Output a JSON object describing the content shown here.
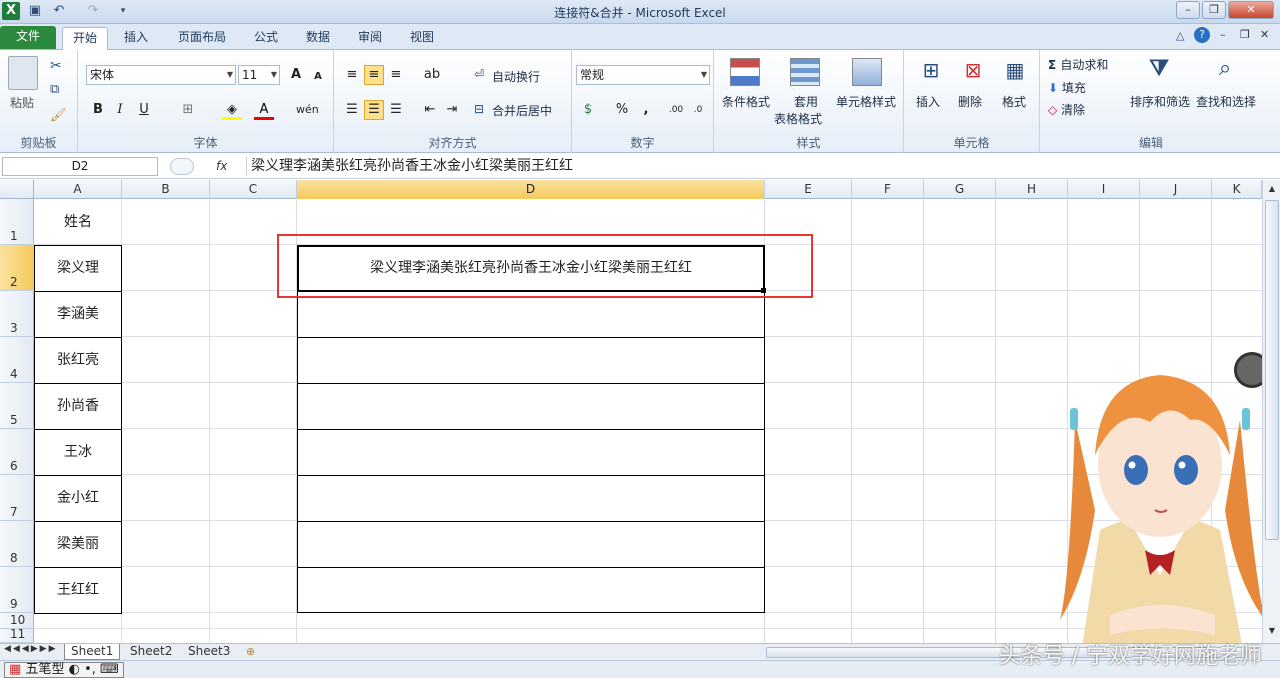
{
  "window": {
    "title": "连接符&合并 - Microsoft Excel"
  },
  "tabs": [
    {
      "label": "文件"
    },
    {
      "label": "开始"
    },
    {
      "label": "插入"
    },
    {
      "label": "页面布局"
    },
    {
      "label": "公式"
    },
    {
      "label": "数据"
    },
    {
      "label": "审阅"
    },
    {
      "label": "视图"
    }
  ],
  "ribbon": {
    "clipboard": {
      "label": "剪贴板",
      "paste": "粘贴"
    },
    "font": {
      "label": "字体",
      "name": "宋体",
      "size": "11"
    },
    "alignment": {
      "label": "对齐方式",
      "wrap": "自动换行",
      "merge": "合并后居中"
    },
    "number": {
      "label": "数字",
      "format": "常规",
      "percent": "%",
      "comma": ","
    },
    "styles": {
      "label": "样式",
      "conditional": "条件格式",
      "table_line1": "套用",
      "table_line2": "表格格式",
      "cell_styles": "单元格样式"
    },
    "cells": {
      "label": "单元格",
      "insert": "插入",
      "delete": "删除",
      "format": "格式"
    },
    "editing": {
      "label": "编辑",
      "autosum": "自动求和",
      "fill": "填充",
      "clear": "清除",
      "sort": "排序和筛选",
      "find": "查找和选择"
    }
  },
  "formula_bar": {
    "name_box": "D2",
    "fx": "fx",
    "content": "梁义理李涵美张红亮孙尚香王冰金小红梁美丽王红红"
  },
  "columns": [
    "A",
    "B",
    "C",
    "D",
    "E",
    "F",
    "G",
    "H",
    "I",
    "J",
    "K"
  ],
  "rows": [
    "1",
    "2",
    "3",
    "4",
    "5",
    "6",
    "7",
    "8",
    "9",
    "10",
    "11"
  ],
  "cells": {
    "A1": "姓名",
    "A_names": [
      "梁义理",
      "李涵美",
      "张红亮",
      "孙尚香",
      "王冰",
      "金小红",
      "梁美丽",
      "王红红"
    ],
    "D2": "梁义理李涵美张红亮孙尚香王冰金小红梁美丽王红红"
  },
  "sheets": [
    "Sheet1",
    "Sheet2",
    "Sheet3"
  ],
  "status": {
    "ime": "五笔型"
  },
  "watermark": "头条号 / 宁双学好网施老师",
  "colors": {
    "accent_red": "#e33333",
    "selected_header": "#f4c95a",
    "file_tab": "#2b8a3e"
  }
}
